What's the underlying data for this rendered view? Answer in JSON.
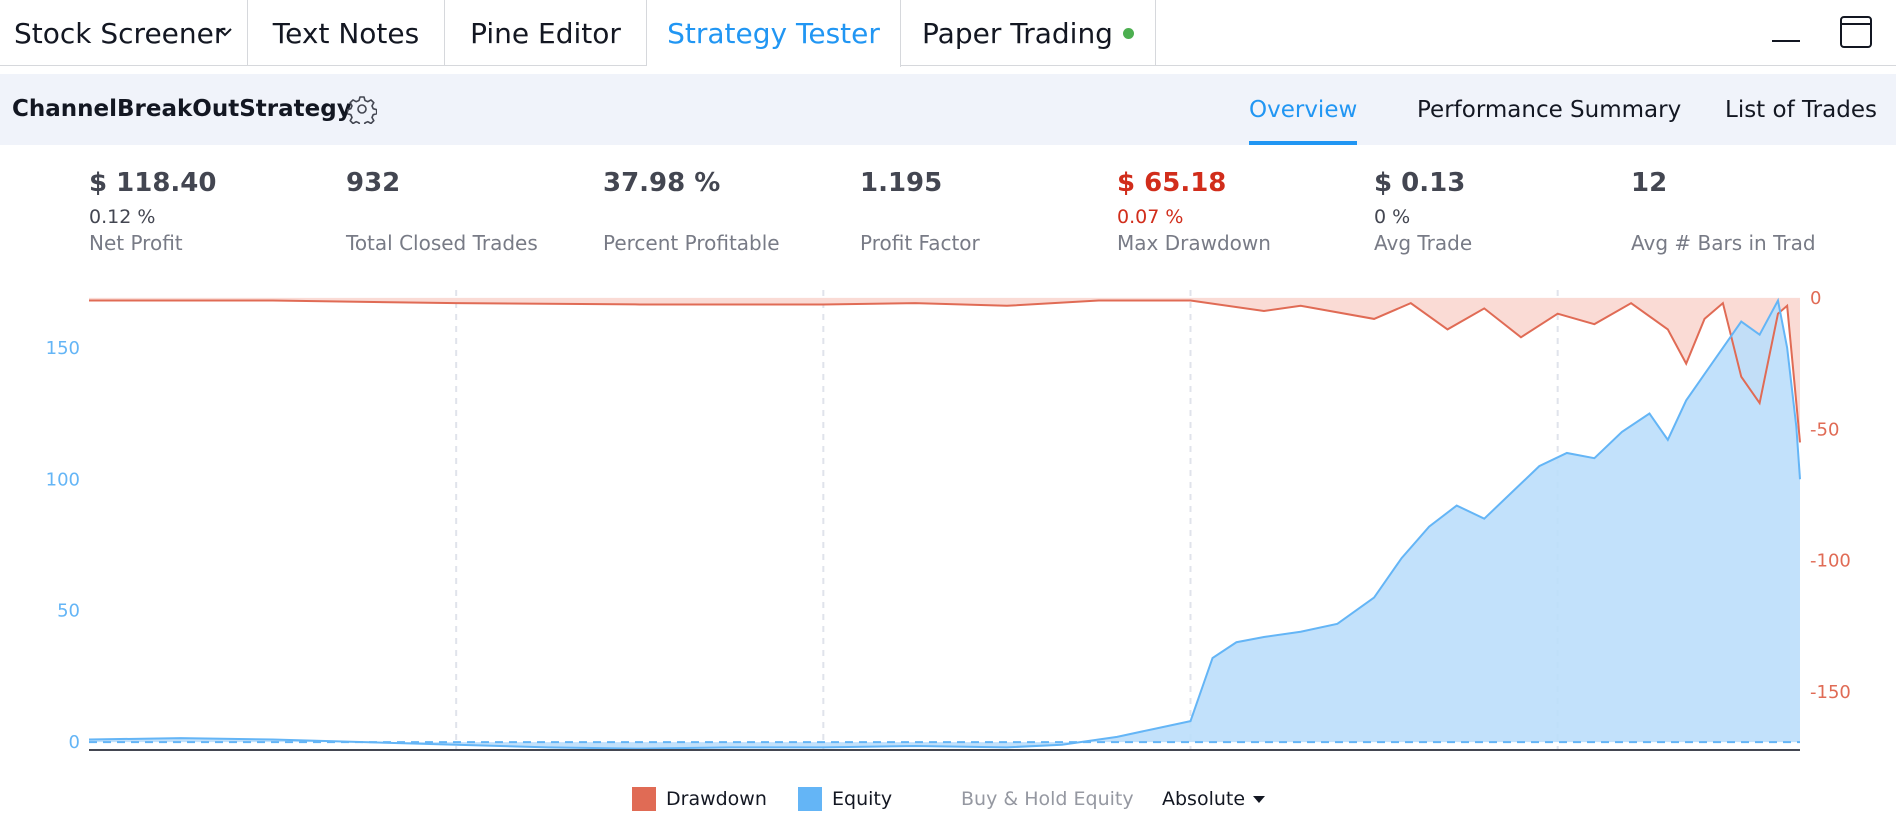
{
  "tabs": {
    "stock_screener": "Stock Screener",
    "text_notes": "Text Notes",
    "pine_editor": "Pine Editor",
    "strategy_tester": "Strategy Tester",
    "paper_trading": "Paper Trading"
  },
  "strategy": {
    "name": "ChannelBreakOutStrategy",
    "tabs": {
      "overview": "Overview",
      "performance_summary": "Performance Summary",
      "list_of_trades": "List of Trades"
    }
  },
  "stats": [
    {
      "value": "$ 118.40",
      "pct": "0.12 %",
      "label": "Net Profit"
    },
    {
      "value": "932",
      "pct": "",
      "label": "Total Closed Trades"
    },
    {
      "value": "37.98 %",
      "pct": "",
      "label": "Percent Profitable"
    },
    {
      "value": "1.195",
      "pct": "",
      "label": "Profit Factor"
    },
    {
      "value": "$ 65.18",
      "pct": "0.07 %",
      "label": "Max Drawdown"
    },
    {
      "value": "$ 0.13",
      "pct": "0 %",
      "label": "Avg Trade"
    },
    {
      "value": "12",
      "pct": "",
      "label": "Avg # Bars in Trad"
    }
  ],
  "legend": {
    "drawdown": "Drawdown",
    "equity": "Equity",
    "buy_hold": "Buy & Hold Equity",
    "mode": "Absolute"
  },
  "colors": {
    "accent": "#2196f3",
    "equity": "#64b5f6",
    "equity_fill": "#bbdefb",
    "drawdown": "#e06b55",
    "drawdown_fill": "#fadbd5",
    "negative": "#d12d1b",
    "live": "#4caf50"
  },
  "icons": {
    "tab_menu": "chevron-down-icon",
    "minimize": "minimize-icon",
    "maximize": "maximize-icon",
    "settings": "gear-icon"
  },
  "chart_data": {
    "type": "area",
    "x_ticks": [
      "200",
      "400",
      "600",
      "800"
    ],
    "xlim": [
      0,
      932
    ],
    "left_axis": {
      "ticks": [
        "0",
        "50",
        "100",
        "150"
      ],
      "range": [
        -3,
        172
      ]
    },
    "right_axis": {
      "ticks": [
        "0",
        "-50",
        "-100",
        "-150"
      ],
      "range": [
        -172,
        3
      ]
    },
    "series": [
      {
        "name": "Equity",
        "x": [
          0,
          50,
          100,
          150,
          200,
          250,
          300,
          350,
          400,
          450,
          500,
          530,
          560,
          580,
          600,
          605,
          612,
          625,
          640,
          660,
          680,
          700,
          715,
          730,
          745,
          760,
          775,
          790,
          805,
          820,
          835,
          850,
          860,
          870,
          880,
          890,
          900,
          910,
          920,
          925,
          930,
          932
        ],
        "values": [
          1,
          1.5,
          1,
          0,
          -1,
          -2,
          -2.5,
          -2,
          -2,
          -1.5,
          -2,
          -1,
          2,
          5,
          8,
          18,
          32,
          38,
          40,
          42,
          45,
          55,
          70,
          82,
          90,
          85,
          95,
          105,
          110,
          108,
          118,
          125,
          115,
          130,
          140,
          150,
          160,
          155,
          168,
          150,
          120,
          100
        ]
      },
      {
        "name": "Drawdown",
        "x": [
          0,
          100,
          200,
          300,
          400,
          450,
          500,
          550,
          600,
          640,
          660,
          700,
          720,
          740,
          760,
          780,
          800,
          820,
          840,
          860,
          870,
          880,
          890,
          900,
          910,
          920,
          925,
          930,
          932
        ],
        "values": [
          -1,
          -1,
          -2,
          -2.5,
          -2.5,
          -2,
          -3,
          -1,
          -1,
          -5,
          -3,
          -8,
          -2,
          -12,
          -4,
          -15,
          -6,
          -10,
          -2,
          -12,
          -25,
          -8,
          -2,
          -30,
          -40,
          -6,
          -3,
          -40,
          -55
        ]
      }
    ]
  }
}
